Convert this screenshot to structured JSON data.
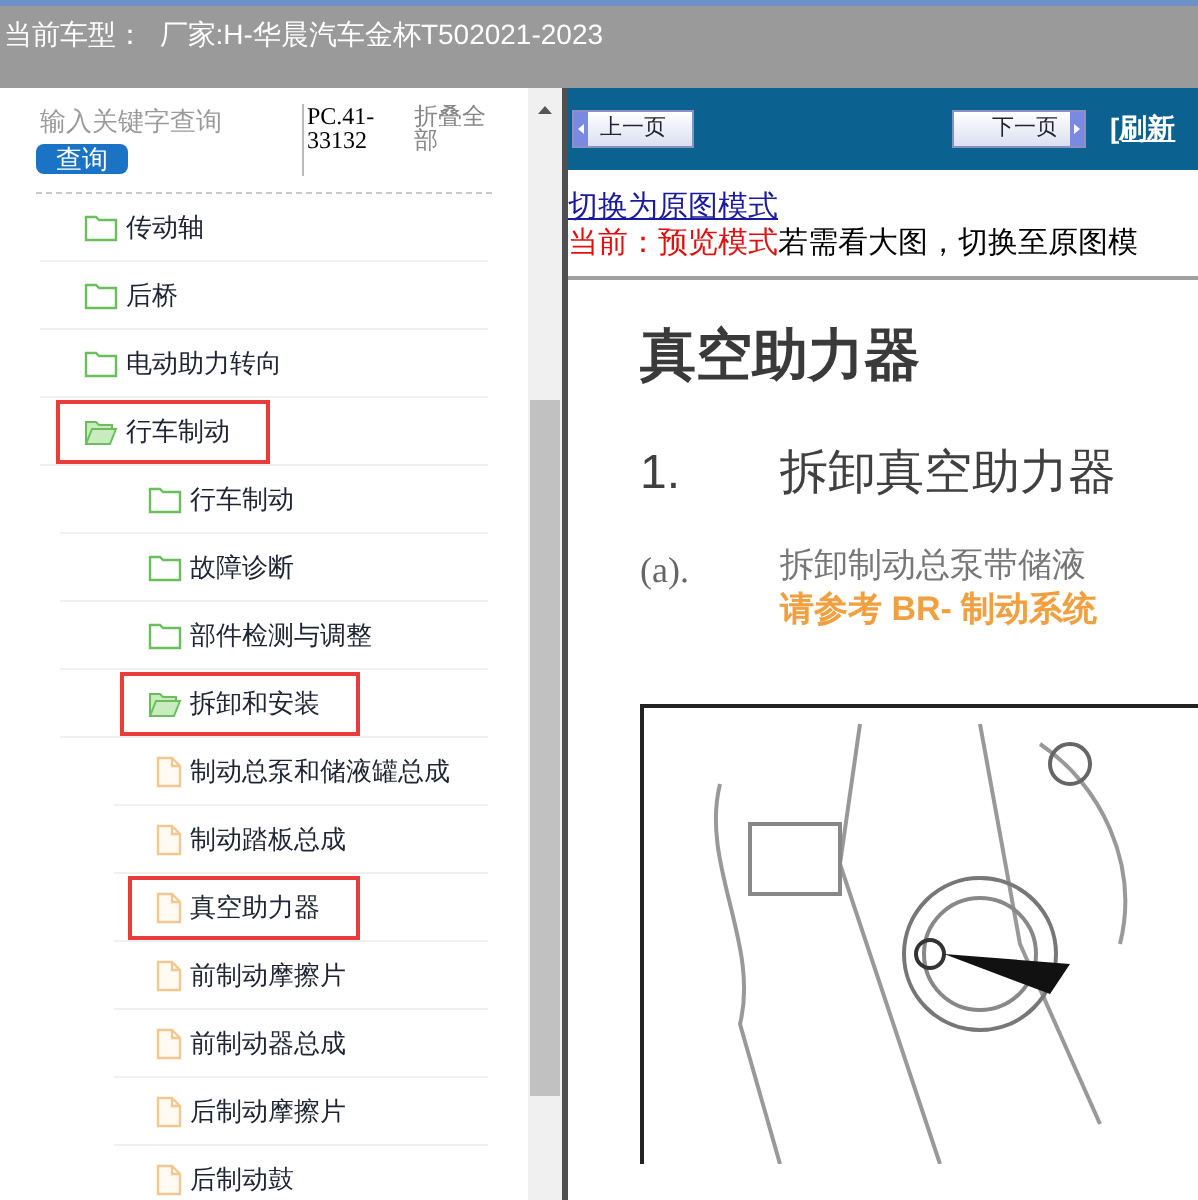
{
  "header": {
    "title": "当前车型：  厂家:H-华晨汽车金杯T502021-2023"
  },
  "sidebar": {
    "search": {
      "placeholder": "输入关键字查询"
    },
    "search_button": "查询",
    "code": "PC.41-33132",
    "collapse_all": "折叠全部",
    "tree": [
      {
        "label": "传动轴",
        "kind": "folder",
        "expanded": false,
        "highlighted": false
      },
      {
        "label": "后桥",
        "kind": "folder",
        "expanded": false,
        "highlighted": false
      },
      {
        "label": "电动助力转向",
        "kind": "folder",
        "expanded": false,
        "highlighted": false
      },
      {
        "label": "行车制动",
        "kind": "folder",
        "expanded": true,
        "highlighted": true,
        "children": [
          {
            "label": "行车制动",
            "kind": "folder",
            "expanded": false,
            "highlighted": false
          },
          {
            "label": "故障诊断",
            "kind": "folder",
            "expanded": false,
            "highlighted": false
          },
          {
            "label": "部件检测与调整",
            "kind": "folder",
            "expanded": false,
            "highlighted": false
          },
          {
            "label": "拆卸和安装",
            "kind": "folder",
            "expanded": true,
            "highlighted": true,
            "children": [
              {
                "label": "制动总泵和储液罐总成",
                "kind": "page",
                "highlighted": false
              },
              {
                "label": "制动踏板总成",
                "kind": "page",
                "highlighted": false
              },
              {
                "label": "真空助力器",
                "kind": "page",
                "highlighted": true
              },
              {
                "label": "前制动摩擦片",
                "kind": "page",
                "highlighted": false
              },
              {
                "label": "前制动器总成",
                "kind": "page",
                "highlighted": false
              },
              {
                "label": "后制动摩擦片",
                "kind": "page",
                "highlighted": false
              },
              {
                "label": "后制动鼓",
                "kind": "page",
                "highlighted": false
              }
            ]
          }
        ]
      }
    ]
  },
  "viewer": {
    "prev_button": "上一页",
    "next_button": "下一页",
    "refresh_link": "[刷新",
    "mode_link": "切换为原图模式",
    "mode_status": "当前：预览模式",
    "mode_hint": "若需看大图，切换至原图模",
    "document": {
      "title": "真空助力器",
      "step_number": "1.",
      "step_title": "拆卸真空助力器",
      "substep_number": "(a).",
      "substep_text": "拆卸制动总泵带储液",
      "reference": "请参考 BR- 制动系统"
    }
  }
}
